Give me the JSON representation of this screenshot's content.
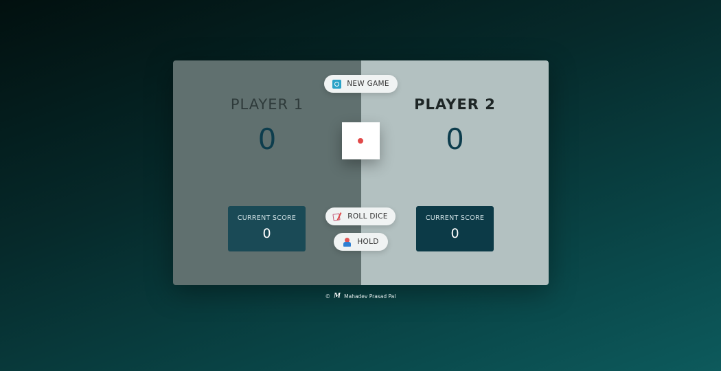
{
  "players": [
    {
      "name": "PLAYER 1",
      "score": "0",
      "current_label": "CURRENT SCORE",
      "current_score": "0",
      "active": false
    },
    {
      "name": "PLAYER 2",
      "score": "0",
      "current_label": "CURRENT SCORE",
      "current_score": "0",
      "active": true
    }
  ],
  "controls": {
    "new_game": "NEW GAME",
    "roll_dice": "ROLL DICE",
    "hold": "HOLD"
  },
  "dice": {
    "value": 1,
    "pip_color": "#e14a4a"
  },
  "footer": {
    "copyright": "©",
    "author": "Mahadev Prasad Pal",
    "logo_text": "M"
  },
  "icons": {
    "new_game": "refresh-icon",
    "roll_dice": "dice-roll-icon",
    "hold": "hold-icon"
  },
  "colors": {
    "panel_left": "#60706f",
    "panel_right": "#b3c1c1",
    "score_color": "#0d3d4d",
    "current_box": "#0c3a47"
  }
}
